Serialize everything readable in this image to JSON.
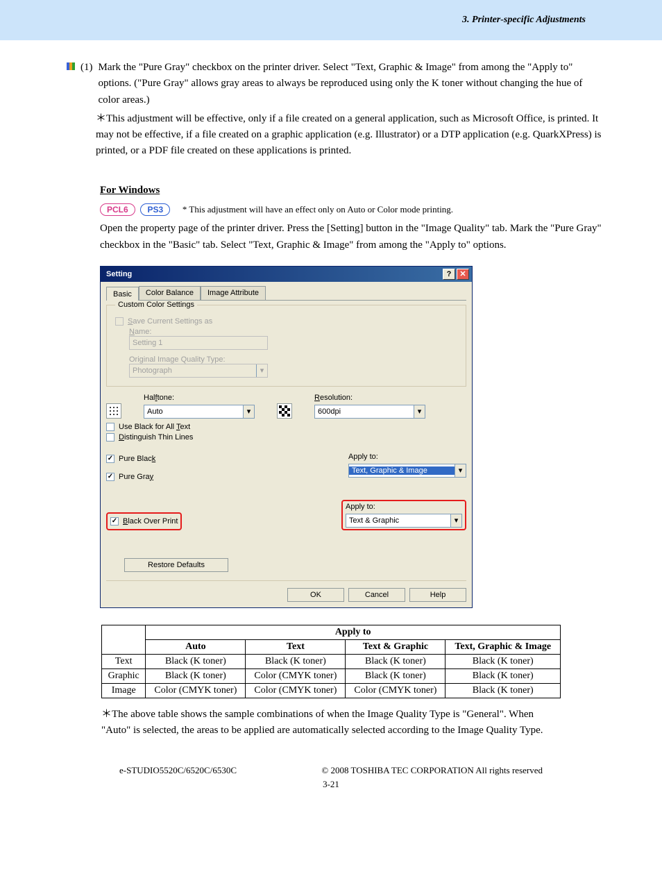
{
  "header": {
    "title": "3. Printer-specific Adjustments"
  },
  "step": {
    "num": "(1)",
    "text": "Mark the \"Pure Gray\" checkbox on the printer driver.  Select \"Text, Graphic & Image\" from among the \"Apply to\" options. (\"Pure Gray\" allows gray areas to always be reproduced using only the K toner without changing the hue of color areas.)",
    "star_note": "This adjustment will be effective, only if a file created on a general application, such as Microsoft Office, is printed.  It may not be effective, if a file created on a graphic application (e.g. Illustrator) or a DTP application (e.g. QuarkXPress) is printed, or a PDF file created on these applications is printed."
  },
  "windows": {
    "heading": "For Windows",
    "badges": {
      "pcl": "PCL6",
      "ps": "PS3"
    },
    "badge_note": "* This adjustment will have an effect only on Auto or Color mode printing.",
    "body": "Open the property page of the printer driver.  Press the [Setting] button in the \"Image Quality\" tab.  Mark the \"Pure Gray\" checkbox in the \"Basic\" tab.  Select \"Text, Graphic & Image\" from among the \"Apply to\" options."
  },
  "dialog": {
    "title": "Setting",
    "tabs": [
      "Basic",
      "Color Balance",
      "Image Attribute"
    ],
    "custom": {
      "legend": "Custom Color Settings",
      "save_label": "Save Current Settings as",
      "name_label": "Name:",
      "name_value": "Setting 1",
      "type_label": "Original Image Quality Type:",
      "type_value": "Photograph"
    },
    "halftone_label": "Halftone:",
    "halftone_value": "Auto",
    "resolution_label": "Resolution:",
    "resolution_value": "600dpi",
    "chk_useblack": "Use Black for All Text",
    "chk_thinlines": "Distinguish Thin Lines",
    "chk_pureblack": "Pure Black",
    "chk_puregray": "Pure Gray",
    "apply1_label": "Apply to:",
    "apply1_value": "Text, Graphic & Image",
    "chk_blackover": "Black Over Print",
    "apply2_label": "Apply to:",
    "apply2_value": "Text & Graphic",
    "restore": "Restore Defaults",
    "ok": "OK",
    "cancel": "Cancel",
    "help": "Help"
  },
  "table": {
    "header_main": "Apply to",
    "cols": [
      "Auto",
      "Text",
      "Text & Graphic",
      "Text, Graphic & Image"
    ],
    "rows": [
      {
        "label": "Text",
        "cells": [
          "Black (K toner)",
          "Black (K toner)",
          "Black (K toner)",
          "Black (K toner)"
        ]
      },
      {
        "label": "Graphic",
        "cells": [
          "Black (K toner)",
          "Color (CMYK toner)",
          "Black (K toner)",
          "Black (K toner)"
        ]
      },
      {
        "label": "Image",
        "cells": [
          "Color (CMYK toner)",
          "Color (CMYK toner)",
          "Color (CMYK toner)",
          "Black (K toner)"
        ]
      }
    ]
  },
  "table_note": "The above table shows the sample combinations of when the Image Quality Type is \"General\". When \"Auto\" is selected, the areas to be applied are automatically selected according to the Image Quality Type.",
  "footer": {
    "left": "e-STUDIO5520C/6520C/6530C",
    "right": "© 2008 TOSHIBA TEC CORPORATION All rights reserved",
    "page": "3-21"
  }
}
